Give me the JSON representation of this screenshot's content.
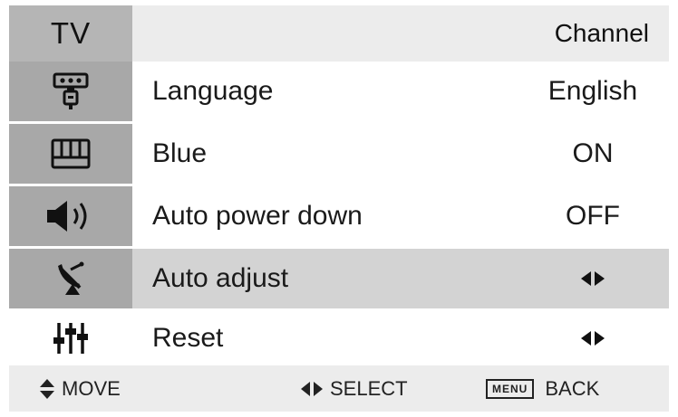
{
  "header": {
    "tv_label": "TV",
    "title": "Channel"
  },
  "menu": {
    "items": [
      {
        "label": "Language",
        "value": "English",
        "icon": "antenna-plug-icon"
      },
      {
        "label": "Blue",
        "value": "ON",
        "icon": "keyboard-icon"
      },
      {
        "label": "Auto power down",
        "value": "OFF",
        "icon": "speaker-icon"
      },
      {
        "label": "Auto adjust",
        "value": "◆",
        "icon": "satellite-dish-icon",
        "selected": true
      },
      {
        "label": "Reset",
        "value": "◆",
        "icon": "equalizer-icon"
      }
    ]
  },
  "footer": {
    "move_label": "MOVE",
    "select_label": "SELECT",
    "menu_key": "MENU",
    "back_label": "BACK"
  },
  "colors": {
    "header_bg": "#ececec",
    "icon_column": "#a8a8a8",
    "selected_row": "#d3d3d3",
    "footer_bg": "#ececec"
  }
}
